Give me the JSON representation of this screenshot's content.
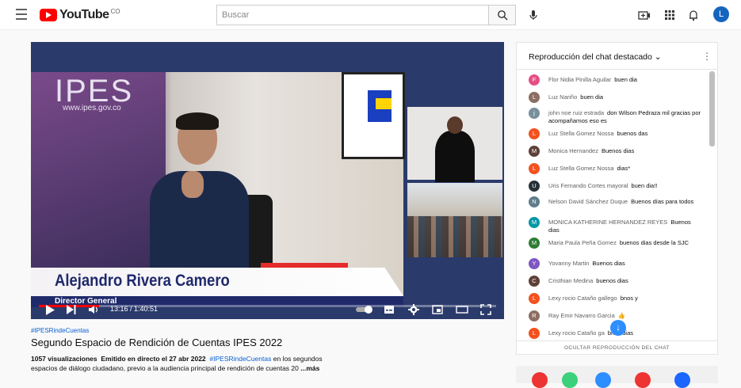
{
  "header": {
    "logo_text": "YouTube",
    "country_code": "CO",
    "search_placeholder": "Buscar",
    "avatar_letter": "L"
  },
  "video": {
    "overlay_ipes": "IPES",
    "overlay_url": "www.ipes.gov.co",
    "lower_third_name": "Alejandro Rivera Camero",
    "lower_third_role": "Director General",
    "time_display": "13:16 / 1:40:51",
    "progress_fraction": 0.132
  },
  "info": {
    "hashtag_above": "#IPESRindeCuentas",
    "title": "Segundo Espacio de Rendición de Cuentas IPES 2022",
    "views": "1057 visualizaciones",
    "aired": "Emitido en directo el 27 abr 2022",
    "hashtag_inline": "#IPESRindeCuentas",
    "desc_part1": "en los segundos",
    "desc_part2": "espacios de diálogo ciudadano, previo a la audiencia principal de rendición de cuentas 20",
    "more_label": "...más"
  },
  "chat": {
    "title": "Reproducción del chat destacado",
    "footer_label": "OCULTAR REPRODUCCIÓN DEL CHAT",
    "messages": [
      {
        "author": "Flor Nidia Pinilla Aguilar",
        "text": "buen dia",
        "initial": "F",
        "color": "#e54f85"
      },
      {
        "author": "Luz Nariño",
        "text": "buen dia",
        "initial": "L",
        "color": "#8d6e63"
      },
      {
        "author": "john noe ruiz estrada",
        "text": "don Wilson Pedraza mil gracias por acompañarnos eso es",
        "initial": "j",
        "color": "#78909c"
      },
      {
        "author": "Luz Stella Gomez Nossa",
        "text": "buenos das",
        "initial": "L",
        "color": "#f4511e"
      },
      {
        "author": "Monica Hernandez",
        "text": "Buenos dias",
        "initial": "M",
        "color": "#5d4037"
      },
      {
        "author": "Luz Stella Gomez Nossa",
        "text": "dias*",
        "initial": "L",
        "color": "#f4511e"
      },
      {
        "author": "Uris Fernando Cortes mayoral",
        "text": "buen dia!!",
        "initial": "U",
        "color": "#263238"
      },
      {
        "author": "Nelson David Sánchez Duque",
        "text": "Buenos días para todos",
        "initial": "N",
        "color": "#607d8b"
      },
      {
        "author": "MONICA KATHERINE HERNANDEZ REYES",
        "text": "Buenos dias",
        "initial": "M",
        "color": "#0097a7"
      },
      {
        "author": "Maria Paula Peña Gomez",
        "text": "buenos dias desde la SJC",
        "initial": "M",
        "color": "#2e7d32"
      },
      {
        "author": "Yovanny Martin",
        "text": "Buenos dias",
        "initial": "Y",
        "color": "#7e57c2"
      },
      {
        "author": "Cristhian Medina",
        "text": "buenos dias",
        "initial": "C",
        "color": "#5d4037"
      },
      {
        "author": "Lexy rocio Cataño gallego",
        "text": "bnos y",
        "initial": "L",
        "color": "#f4511e"
      },
      {
        "author": "Ray Emir Navarro Garcia",
        "text": "👍",
        "initial": "R",
        "color": "#8d6e63"
      },
      {
        "author": "Lexy rocio Cataño ga",
        "text": "bnos dias",
        "initial": "L",
        "color": "#f4511e"
      }
    ]
  },
  "colors": {
    "brand_red": "#ff0000",
    "link_blue": "#065fd4"
  }
}
